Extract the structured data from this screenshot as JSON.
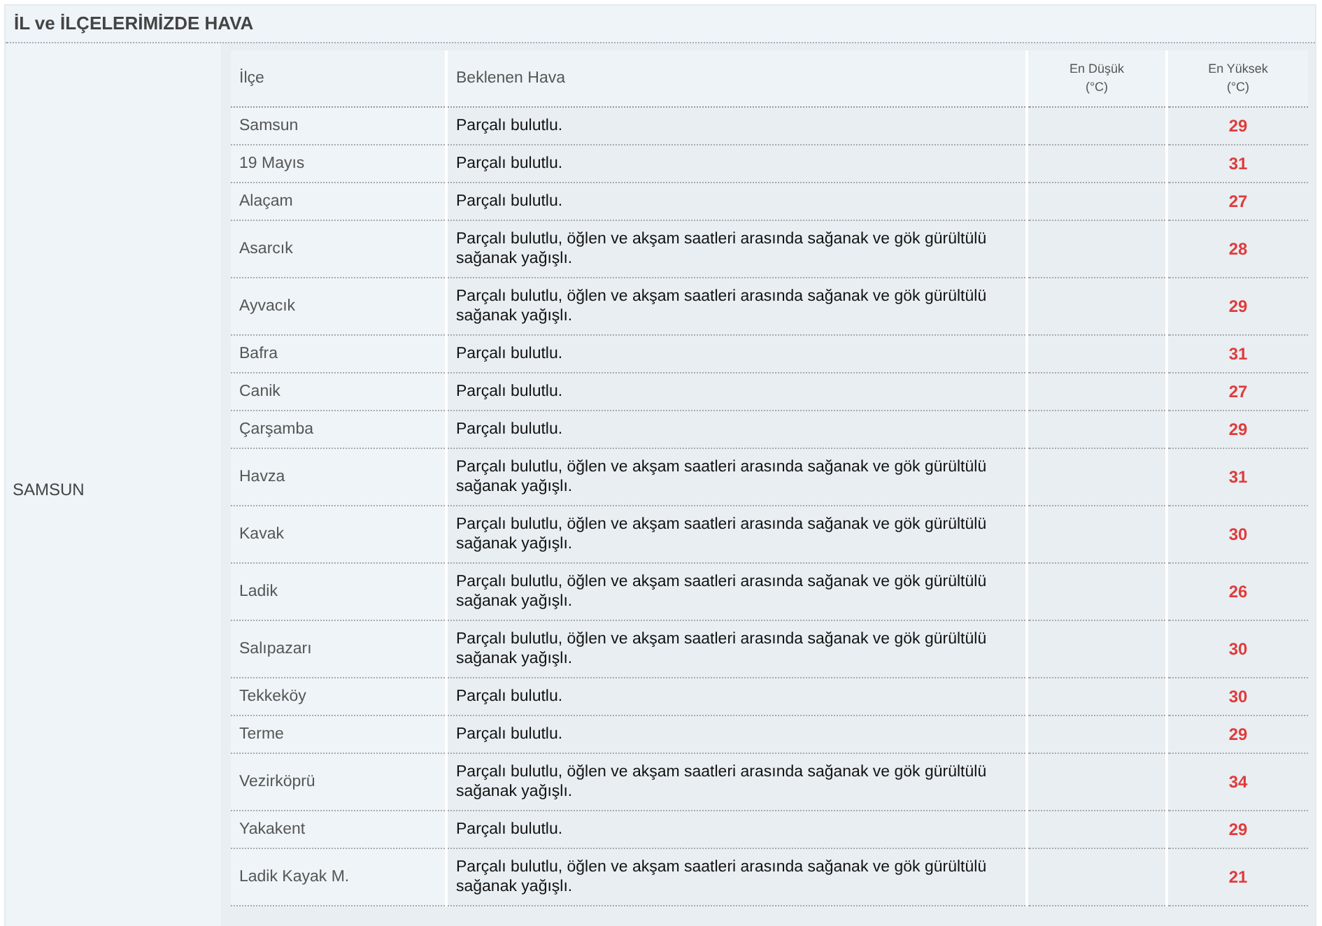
{
  "title": "İL ve İLÇELERİMİZDE HAVA",
  "province": "SAMSUN",
  "columns": [
    {
      "label": "İlçe"
    },
    {
      "label": "Beklenen Hava"
    },
    {
      "label": "En Düşük",
      "sub": "(°C)"
    },
    {
      "label": "En Yüksek",
      "sub": "(°C)"
    }
  ],
  "rows": [
    {
      "district": "Samsun",
      "forecast": "Parçalı bulutlu.",
      "high": "29"
    },
    {
      "district": "19 Mayıs",
      "forecast": "Parçalı bulutlu.",
      "high": "31"
    },
    {
      "district": "Alaçam",
      "forecast": "Parçalı bulutlu.",
      "high": "27"
    },
    {
      "district": "Asarcık",
      "forecast": "Parçalı bulutlu, öğlen ve akşam saatleri arasında sağanak ve gök gürültülü sağanak yağışlı.",
      "high": "28"
    },
    {
      "district": "Ayvacık",
      "forecast": "Parçalı bulutlu, öğlen ve akşam saatleri arasında sağanak ve gök gürültülü sağanak yağışlı.",
      "high": "29"
    },
    {
      "district": "Bafra",
      "forecast": "Parçalı bulutlu.",
      "high": "31"
    },
    {
      "district": "Canik",
      "forecast": "Parçalı bulutlu.",
      "high": "27"
    },
    {
      "district": "Çarşamba",
      "forecast": "Parçalı bulutlu.",
      "high": "29"
    },
    {
      "district": "Havza",
      "forecast": "Parçalı bulutlu, öğlen ve akşam saatleri arasında sağanak ve gök gürültülü sağanak yağışlı.",
      "high": "31"
    },
    {
      "district": "Kavak",
      "forecast": "Parçalı bulutlu, öğlen ve akşam saatleri arasında sağanak ve gök gürültülü sağanak yağışlı.",
      "high": "30"
    },
    {
      "district": "Ladik",
      "forecast": "Parçalı bulutlu, öğlen ve akşam saatleri arasında sağanak ve gök gürültülü sağanak yağışlı.",
      "high": "26"
    },
    {
      "district": "Salıpazarı",
      "forecast": "Parçalı bulutlu, öğlen ve akşam saatleri arasında sağanak ve gök gürültülü sağanak yağışlı.",
      "high": "30"
    },
    {
      "district": "Tekkeköy",
      "forecast": "Parçalı bulutlu.",
      "high": "30"
    },
    {
      "district": "Terme",
      "forecast": "Parçalı bulutlu.",
      "high": "29"
    },
    {
      "district": "Vezirköprü",
      "forecast": "Parçalı bulutlu, öğlen ve akşam saatleri arasında sağanak ve gök gürültülü sağanak yağışlı.",
      "high": "34"
    },
    {
      "district": "Yakakent",
      "forecast": "Parçalı bulutlu.",
      "high": "29"
    },
    {
      "district": "Ladik Kayak M.",
      "forecast": "Parçalı bulutlu, öğlen ve akşam saatleri arasında sağanak ve gök gürültülü sağanak yağışlı.",
      "high": "21"
    }
  ]
}
